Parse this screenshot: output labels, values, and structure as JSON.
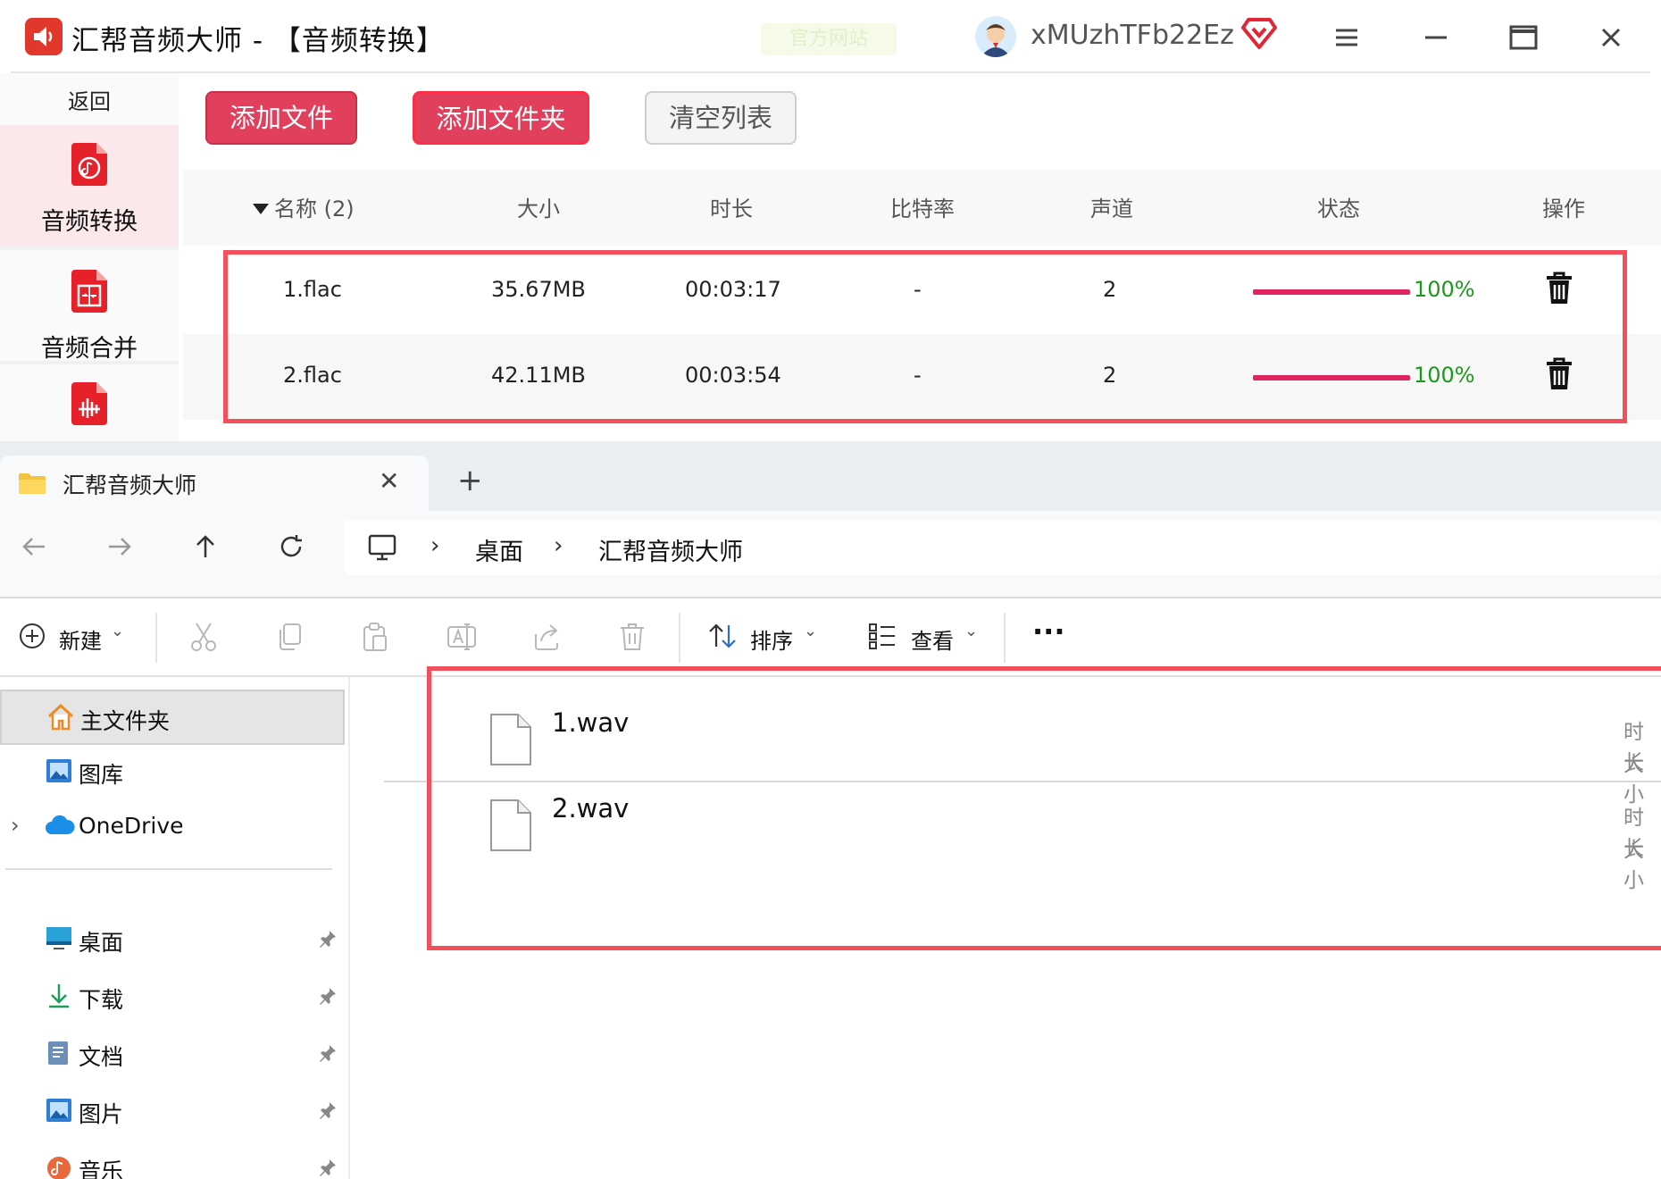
{
  "app": {
    "title": "汇帮音频大师 - 【音频转换】",
    "ghost_badge": "官方网站",
    "username": "xMUzhTFb22Ez",
    "sidebar": {
      "back": "返回",
      "items": [
        {
          "label": "音频转换",
          "active": true,
          "icon": "audio-convert-icon"
        },
        {
          "label": "音频合并",
          "active": false,
          "icon": "audio-merge-icon"
        },
        {
          "label": "",
          "active": false,
          "icon": "audio-wave-icon"
        }
      ]
    },
    "toolbar": {
      "add_file": "添加文件",
      "add_folder": "添加文件夹",
      "clear_list": "清空列表"
    },
    "table": {
      "columns": [
        "名称 (2)",
        "大小",
        "时长",
        "比特率",
        "声道",
        "状态",
        "操作"
      ],
      "rows": [
        {
          "name": "1.flac",
          "size": "35.67MB",
          "duration": "00:03:17",
          "bitrate": "-",
          "channels": "2",
          "progress": 1.0,
          "progress_label": "100%"
        },
        {
          "name": "2.flac",
          "size": "42.11MB",
          "duration": "00:03:54",
          "bitrate": "-",
          "channels": "2",
          "progress": 1.0,
          "progress_label": "100%"
        }
      ]
    },
    "colors": {
      "accent": "#e0405c",
      "progress": "#e0245e",
      "percent": "#1a9a1a",
      "highlight": "#f2505a"
    }
  },
  "explorer": {
    "tab_title": "汇帮音频大师",
    "breadcrumb": [
      "桌面",
      "汇帮音频大师"
    ],
    "commands": {
      "new": "新建",
      "sort": "排序",
      "view": "查看",
      "more": "···"
    },
    "nav": {
      "home": "主文件夹",
      "gallery": "图库",
      "onedrive": "OneDrive",
      "quick": [
        {
          "label": "桌面",
          "icon": "desktop-icon"
        },
        {
          "label": "下载",
          "icon": "download-icon"
        },
        {
          "label": "文档",
          "icon": "documents-icon"
        },
        {
          "label": "图片",
          "icon": "pictures-icon"
        },
        {
          "label": "音乐",
          "icon": "music-icon"
        }
      ]
    },
    "files": [
      {
        "name": "1.wav",
        "meta1": "时长",
        "meta2": "大小"
      },
      {
        "name": "2.wav",
        "meta1": "时长",
        "meta2": "大小"
      }
    ]
  }
}
